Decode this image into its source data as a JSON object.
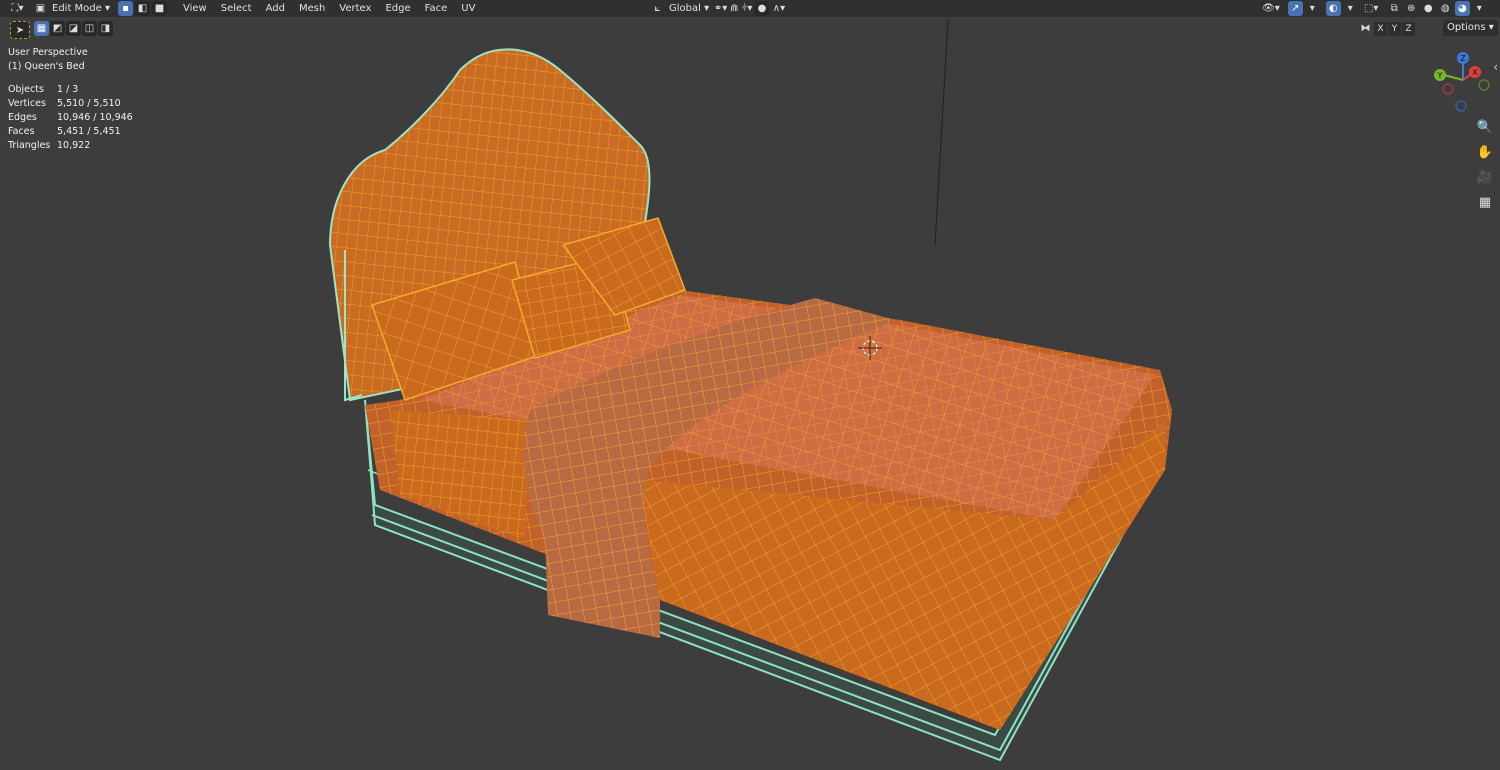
{
  "header": {
    "mode_label": "Edit Mode",
    "menus": [
      "View",
      "Select",
      "Add",
      "Mesh",
      "Vertex",
      "Edge",
      "Face",
      "UV"
    ],
    "transform_orientation": "Global",
    "options_label": "Options",
    "axis_buttons": [
      "X",
      "Y",
      "Z"
    ]
  },
  "overlay": {
    "view_name": "User Perspective",
    "object_name": "(1) Queen's Bed",
    "stats": [
      {
        "label": "Objects",
        "value": "1 / 3"
      },
      {
        "label": "Vertices",
        "value": "5,510 / 5,510"
      },
      {
        "label": "Edges",
        "value": "10,946 / 10,946"
      },
      {
        "label": "Faces",
        "value": "5,451 / 5,451"
      },
      {
        "label": "Triangles",
        "value": "10,922"
      }
    ]
  },
  "gizmo": {
    "x": "X",
    "y": "Y",
    "z": "Z"
  },
  "icons": [
    "editor-type-icon",
    "mode-icon",
    "vertex-select-icon",
    "edge-select-icon",
    "face-select-icon",
    "transform-orientation-icon",
    "pivot-icon",
    "snap-icon",
    "proportional-icon",
    "visibility-icon",
    "gizmo-icon",
    "overlay-icon",
    "xray-icon",
    "shading-icons",
    "zoom-icon",
    "pan-hand-icon",
    "camera-icon",
    "grid-icon"
  ],
  "colors": {
    "viewport_bg": "#3d3d3d",
    "header_bg": "#303030",
    "accent": "#4772b3",
    "selected_mesh": "#f5a21f",
    "mesh_face": "#c9671e",
    "axis_x": "#e0413e",
    "axis_y": "#78b52e",
    "axis_z": "#3d7ae0"
  }
}
